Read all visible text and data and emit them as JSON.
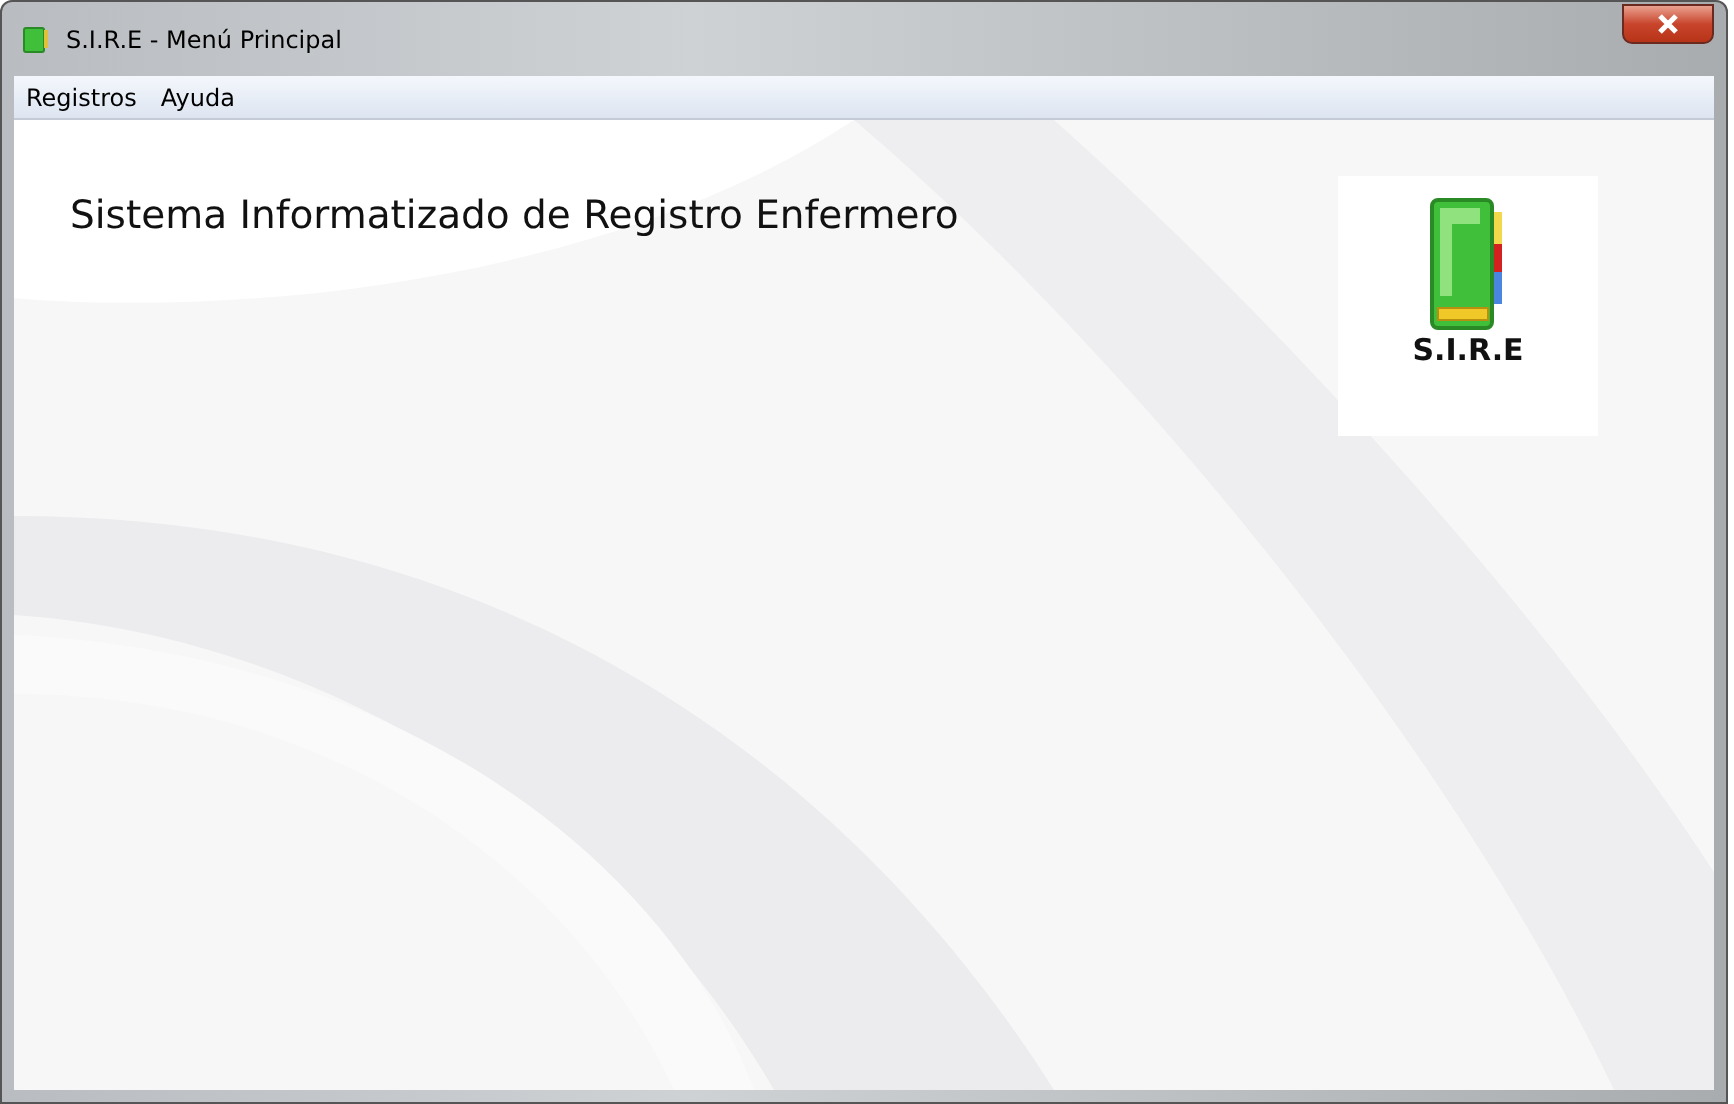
{
  "window": {
    "title": "S.I.R.E - Menú Principal"
  },
  "menu": [
    {
      "label": "Registros"
    },
    {
      "label": "Ayuda"
    }
  ],
  "heading": "Sistema Informatizado de Registro Enfermero",
  "logo": {
    "caption": "S.I.R.E"
  }
}
